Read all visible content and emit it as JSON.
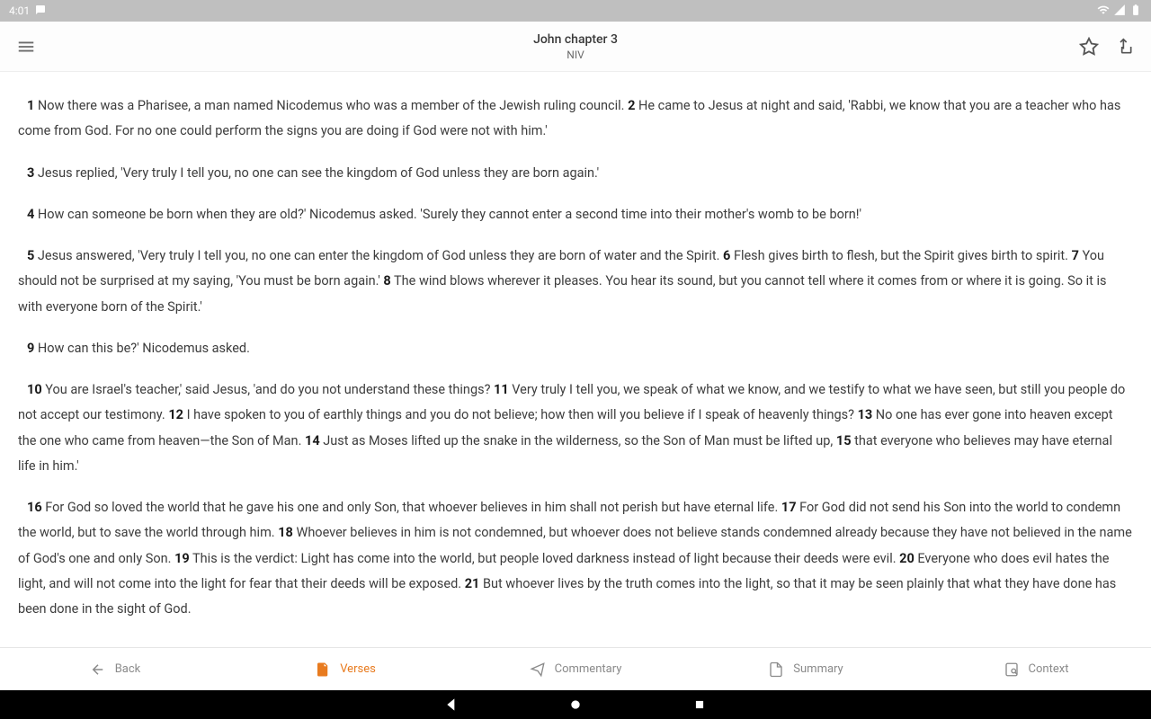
{
  "status": {
    "time": "4:01"
  },
  "header": {
    "title": "John chapter 3",
    "subtitle": "NIV"
  },
  "paragraphs": [
    [
      {
        "n": "1",
        "t": "Now there was a Pharisee, a man named Nicodemus who was a member of the Jewish ruling council."
      },
      {
        "n": "2",
        "t": "He came to Jesus at night and said, 'Rabbi, we know that you are a teacher who has come from God. For no one could perform the signs you are doing if God were not with him.'"
      }
    ],
    [
      {
        "n": "3",
        "t": "Jesus replied, 'Very truly I tell you, no one can see the kingdom of God unless they are born again.'"
      }
    ],
    [
      {
        "n": "4",
        "t": "How can someone be born when they are old?' Nicodemus asked. 'Surely they cannot enter a second time into their mother's womb to be born!'"
      }
    ],
    [
      {
        "n": "5",
        "t": "Jesus answered, 'Very truly I tell you, no one can enter the kingdom of God unless they are born of water and the Spirit."
      },
      {
        "n": "6",
        "t": "Flesh gives birth to flesh, but the Spirit gives birth to spirit."
      },
      {
        "n": "7",
        "t": "You should not be surprised at my saying, 'You must be born again.'"
      },
      {
        "n": "8",
        "t": "The wind blows wherever it pleases. You hear its sound, but you cannot tell where it comes from or where it is going. So it is with everyone born of the Spirit.'"
      }
    ],
    [
      {
        "n": "9",
        "t": "How can this be?' Nicodemus asked."
      }
    ],
    [
      {
        "n": "10",
        "t": "You are Israel's teacher,' said Jesus, 'and do you not understand these things?"
      },
      {
        "n": "11",
        "t": "Very truly I tell you, we speak of what we know, and we testify to what we have seen, but still you people do not accept our testimony."
      },
      {
        "n": "12",
        "t": "I have spoken to you of earthly things and you do not believe; how then will you believe if I speak of heavenly things?"
      },
      {
        "n": "13",
        "t": "No one has ever gone into heaven except the one who came from heaven—the Son of Man."
      },
      {
        "n": "14",
        "t": "Just as Moses lifted up the snake in the wilderness, so the Son of Man must be lifted up,"
      },
      {
        "n": "15",
        "t": "that everyone who believes may have eternal life in him.'"
      }
    ],
    [
      {
        "n": "16",
        "t": "For God so loved the world that he gave his one and only Son, that whoever believes in him shall not perish but have eternal life."
      },
      {
        "n": "17",
        "t": "For God did not send his Son into the world to condemn the world, but to save the world through him."
      },
      {
        "n": "18",
        "t": "Whoever believes in him is not condemned, but whoever does not believe stands condemned already because they have not believed in the name of God's one and only Son."
      },
      {
        "n": "19",
        "t": "This is the verdict: Light has come into the world, but people loved darkness instead of light because their deeds were evil."
      },
      {
        "n": "20",
        "t": "Everyone who does evil hates the light, and will not come into the light for fear that their deeds will be exposed."
      },
      {
        "n": "21",
        "t": "But whoever lives by the truth comes into the light, so that it may be seen plainly that what they have done has been done in the sight of God."
      }
    ]
  ],
  "tabs": {
    "back": "Back",
    "verses": "Verses",
    "commentary": "Commentary",
    "summary": "Summary",
    "context": "Context"
  }
}
